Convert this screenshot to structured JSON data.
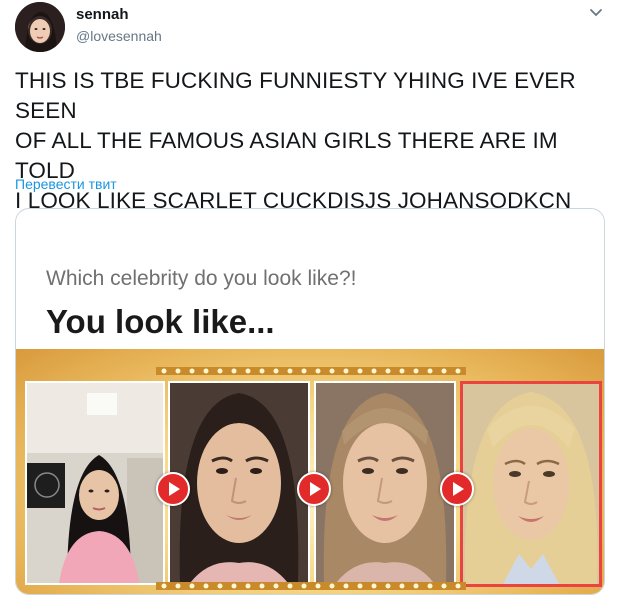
{
  "user": {
    "name": "sennah",
    "handle": "@lovesennah"
  },
  "tweet": {
    "lines": [
      "THIS IS TBE FUCKING FUNNIESTY YHING IVE EVER SEEN",
      "OF ALL THE FAMOUS ASIAN GIRLS THERE ARE IM TOLD",
      "I LOOK LIKE SCARLET CUCKDISJS JOHANSODKCN"
    ],
    "translate_label": "Перевести твит"
  },
  "card": {
    "question": "Which celebrity do you look like?!",
    "title": "You look like...",
    "photos": [
      "user-photo",
      "user-face-closeup",
      "morph-face",
      "celebrity-photo"
    ]
  },
  "colors": {
    "link": "#1b95e0",
    "play": "#e22a2a",
    "frame_highlight": "#e9443f"
  }
}
